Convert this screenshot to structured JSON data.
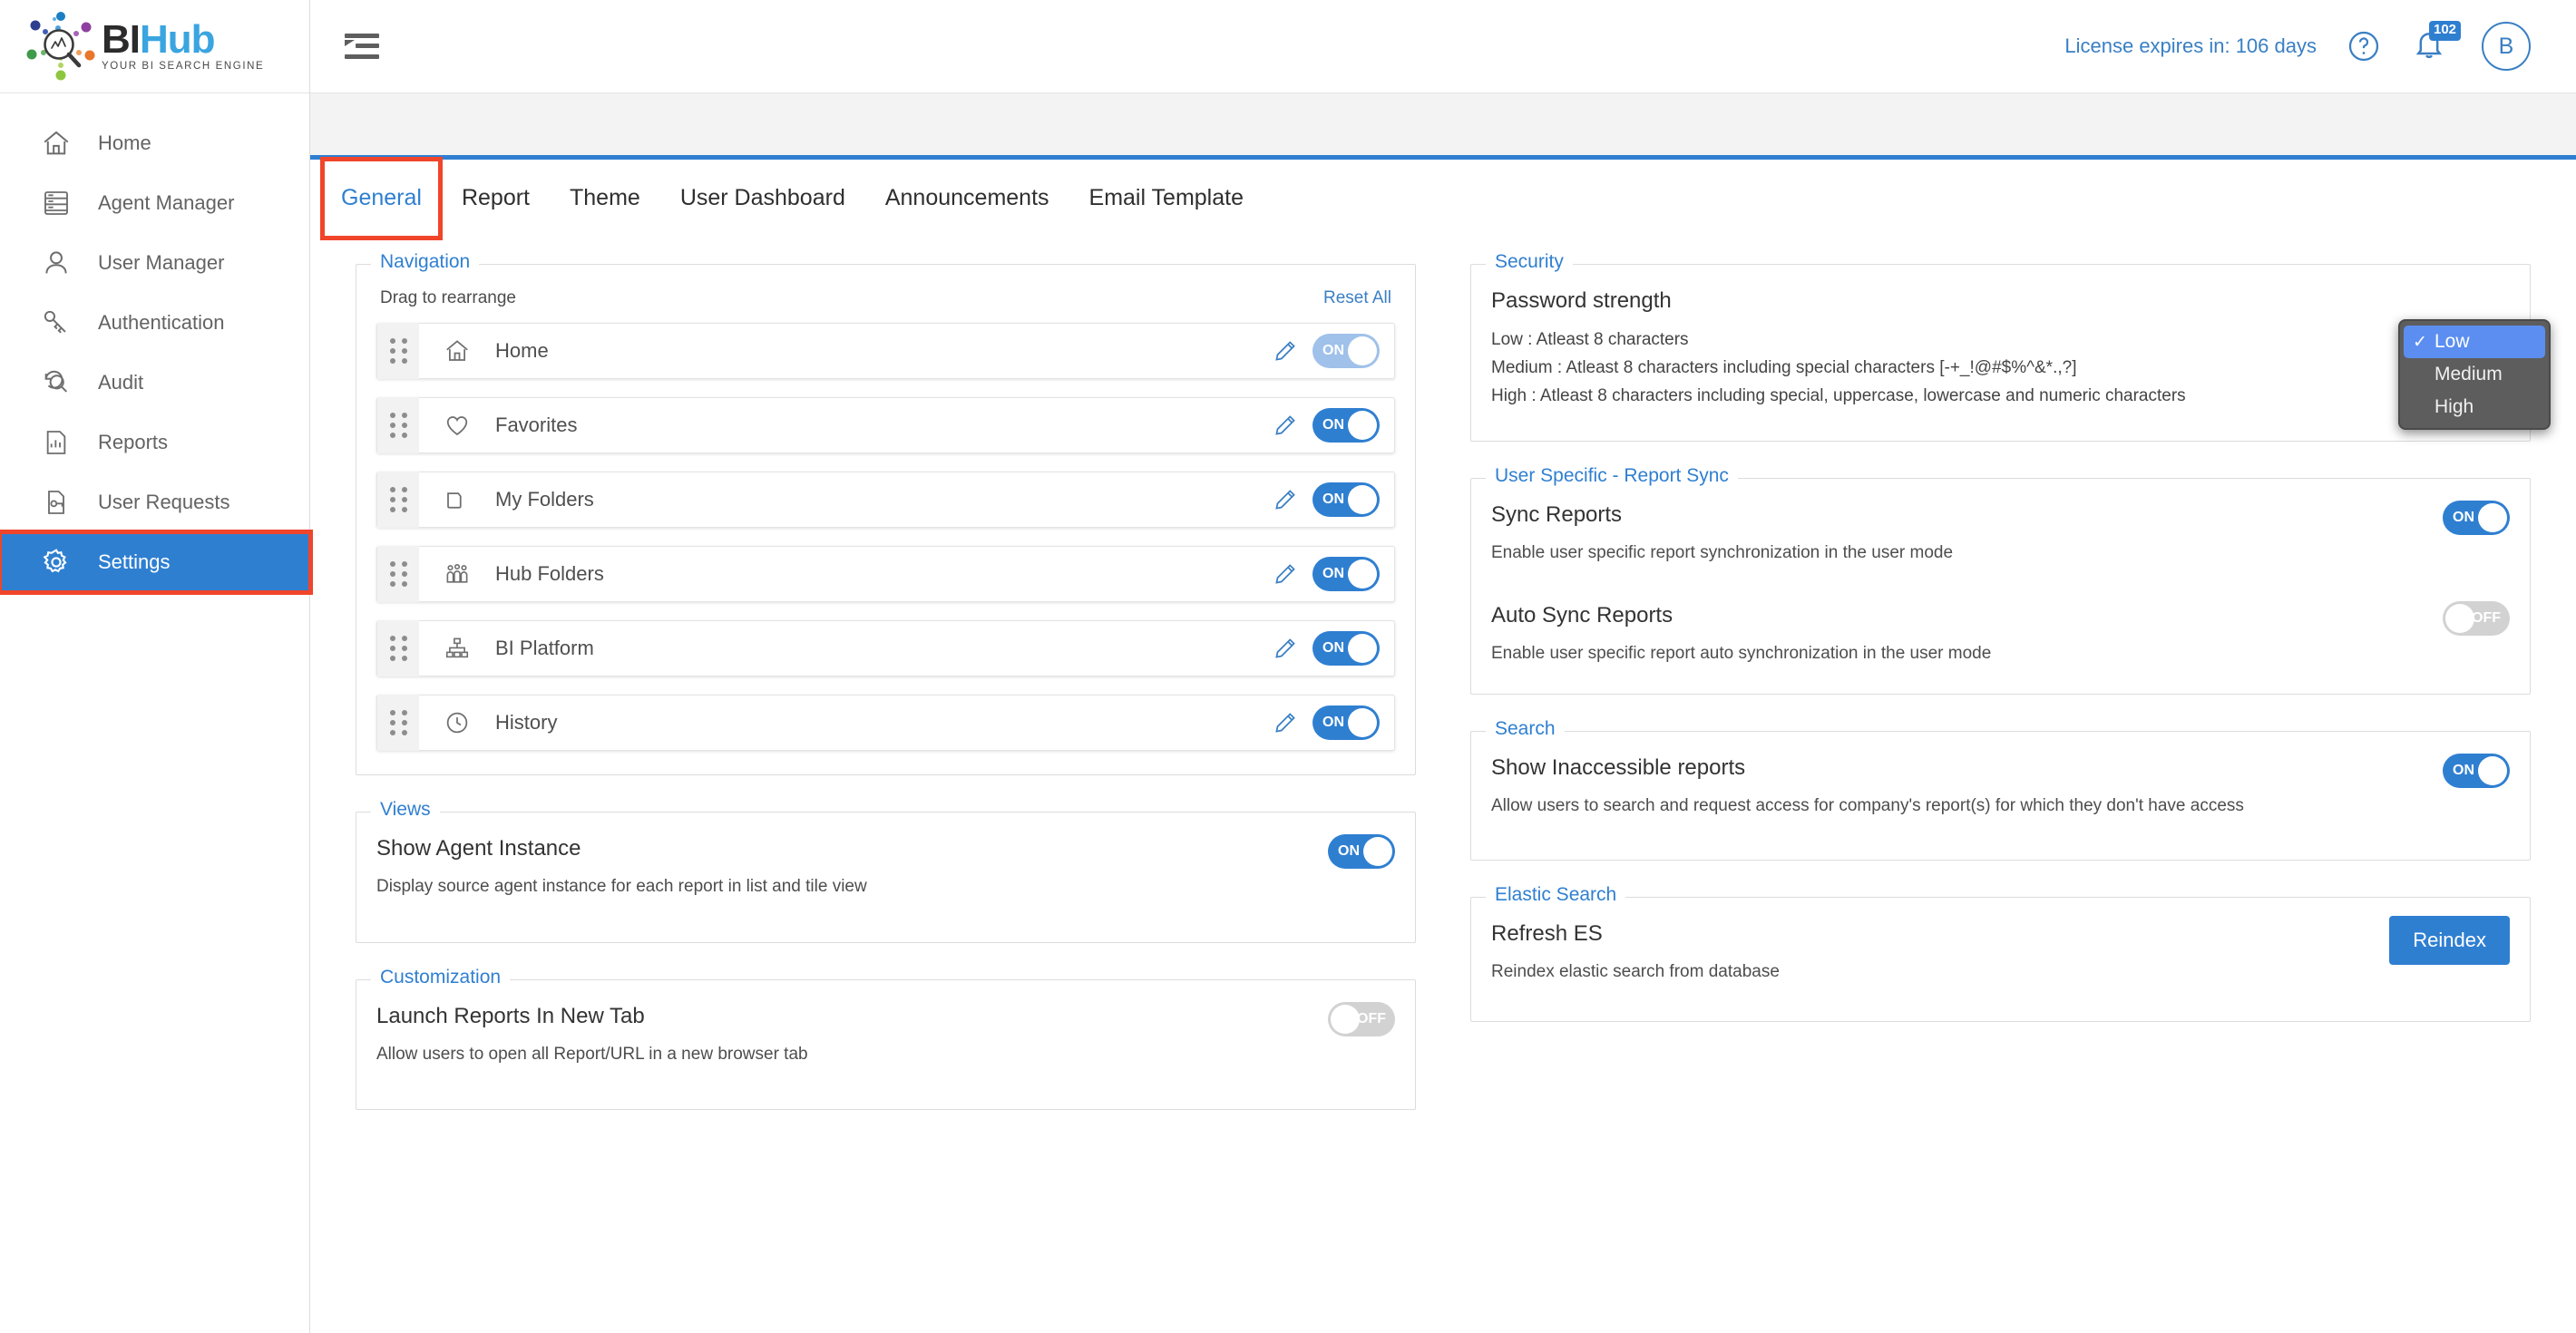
{
  "brand": {
    "name_part1": "BI",
    "name_part2": "Hub",
    "tagline": "YOUR BI SEARCH ENGINE"
  },
  "sidebar": {
    "items": [
      {
        "label": "Home",
        "icon": "home-icon",
        "active": false
      },
      {
        "label": "Agent Manager",
        "icon": "server-list-icon",
        "active": false
      },
      {
        "label": "User Manager",
        "icon": "user-icon",
        "active": false
      },
      {
        "label": "Authentication",
        "icon": "keys-icon",
        "active": false
      },
      {
        "label": "Audit",
        "icon": "audit-search-icon",
        "active": false
      },
      {
        "label": "Reports",
        "icon": "report-chart-icon",
        "active": false
      },
      {
        "label": "User Requests",
        "icon": "request-document-icon",
        "active": false
      },
      {
        "label": "Settings",
        "icon": "gear-icon",
        "active": true
      }
    ]
  },
  "topbar": {
    "menu_icon": "hamburger-collapse-icon",
    "license_text": "License expires in: 106 days",
    "help_icon": "question-circle-icon",
    "bell_icon": "notification-bell-icon",
    "notification_count": "102",
    "avatar_initial": "B"
  },
  "tabs": [
    {
      "label": "General",
      "active": true
    },
    {
      "label": "Report",
      "active": false
    },
    {
      "label": "Theme",
      "active": false
    },
    {
      "label": "User Dashboard",
      "active": false
    },
    {
      "label": "Announcements",
      "active": false
    },
    {
      "label": "Email Template",
      "active": false
    }
  ],
  "navigation": {
    "legend": "Navigation",
    "drag_hint": "Drag to rearrange",
    "reset_all": "Reset All",
    "rows": [
      {
        "label": "Home",
        "icon": "home-icon",
        "toggle": "ON",
        "state": "on-faded"
      },
      {
        "label": "Favorites",
        "icon": "heart-icon",
        "toggle": "ON",
        "state": "on"
      },
      {
        "label": "My Folders",
        "icon": "folder-icon",
        "toggle": "ON",
        "state": "on"
      },
      {
        "label": "Hub Folders",
        "icon": "people-icon",
        "toggle": "ON",
        "state": "on"
      },
      {
        "label": "BI Platform",
        "icon": "sitemap-icon",
        "toggle": "ON",
        "state": "on"
      },
      {
        "label": "History",
        "icon": "clock-icon",
        "toggle": "ON",
        "state": "on"
      }
    ]
  },
  "views": {
    "legend": "Views",
    "title": "Show Agent Instance",
    "desc": "Display source agent instance for each report in list and tile view",
    "toggle": "ON",
    "state": "on"
  },
  "customization": {
    "legend": "Customization",
    "title": "Launch Reports In New Tab",
    "desc": "Allow users to open all Report/URL in a new browser tab",
    "toggle": "OFF",
    "state": "off"
  },
  "security": {
    "legend": "Security",
    "title": "Password strength",
    "line_low": "Low : Atleast 8 characters",
    "line_medium": "Medium : Atleast 8 characters including special characters [-+_!@#$%^&*.,?]",
    "line_high": "High : Atleast 8 characters including special, uppercase, lowercase and numeric characters",
    "dropdown": {
      "open": true,
      "selected": "Low",
      "options": [
        "Low",
        "Medium",
        "High"
      ]
    }
  },
  "report_sync": {
    "legend": "User Specific - Report Sync",
    "items": [
      {
        "title": "Sync Reports",
        "desc": "Enable user specific report synchronization in the user mode",
        "toggle": "ON",
        "state": "on"
      },
      {
        "title": "Auto Sync Reports",
        "desc": "Enable user specific report auto synchronization in the user mode",
        "toggle": "OFF",
        "state": "off"
      }
    ]
  },
  "search": {
    "legend": "Search",
    "title": "Show Inaccessible reports",
    "desc": "Allow users to search and request access for company's report(s) for which they don't have access",
    "toggle": "ON",
    "state": "on"
  },
  "elastic_search": {
    "legend": "Elastic Search",
    "title": "Refresh ES",
    "desc": "Reindex elastic search from database",
    "button_label": "Reindex"
  },
  "colors": {
    "accent_blue": "#2f7fd1",
    "link_blue": "#3a7fc4",
    "annotation_red": "#f0452a",
    "toggle_off_gray": "#d2d2d2",
    "toggle_on_faded": "#9fc1ea",
    "dropdown_bg": "#5d5d5d",
    "dropdown_highlight": "#5b8ef0"
  }
}
